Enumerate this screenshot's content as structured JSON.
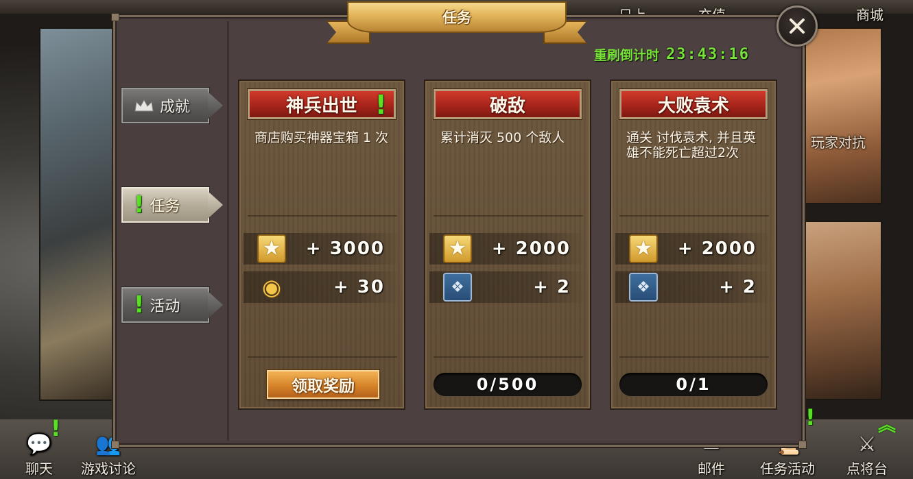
{
  "top_nav": {
    "item1": "日上",
    "item2": "充值",
    "item3": "商城"
  },
  "background": {
    "right_label": "玩家对抗"
  },
  "panel": {
    "title": "任务",
    "refresh_label": "重刷倒计时",
    "refresh_time": "23:43:16"
  },
  "tabs": [
    {
      "label": "成就",
      "icon": "crown-icon",
      "alert": false
    },
    {
      "label": "任务",
      "icon": "alert-icon",
      "alert": true
    },
    {
      "label": "活动",
      "icon": "alert-icon",
      "alert": true
    }
  ],
  "cards": [
    {
      "title": "神兵出世",
      "title_alert": "!",
      "description": "商店购买神器宝箱 1 次",
      "rewards": [
        {
          "icon": "star-icon",
          "amount": "+ 3000"
        },
        {
          "icon": "gold-coins-icon",
          "amount": "+ 30"
        }
      ],
      "action": {
        "type": "button",
        "label": "领取奖励"
      }
    },
    {
      "title": "破敌",
      "description": "累计消灭 500 个敌人",
      "rewards": [
        {
          "icon": "star-icon",
          "amount": "+ 2000"
        },
        {
          "icon": "hero-card-icon",
          "amount": "+ 2"
        }
      ],
      "action": {
        "type": "progress",
        "current": 0,
        "total": 500,
        "text": "0/500"
      }
    },
    {
      "title": "大败袁术",
      "description": "通关 讨伐袁术, 并且英雄不能死亡超过2次",
      "rewards": [
        {
          "icon": "star-icon",
          "amount": "+ 2000"
        },
        {
          "icon": "hero-card-icon",
          "amount": "+ 2"
        }
      ],
      "action": {
        "type": "progress",
        "current": 0,
        "total": 1,
        "text": "0/1"
      }
    }
  ],
  "bottom_bar": {
    "chat": "聊天",
    "discussion": "游戏讨论",
    "mail": "邮件",
    "quest_activity": "任务活动",
    "general_stage": "点将台"
  },
  "colors": {
    "alert_green": "#5be025",
    "timer_green": "#77e237",
    "card_title_red": "#a8251b",
    "claim_orange": "#d7832a"
  }
}
